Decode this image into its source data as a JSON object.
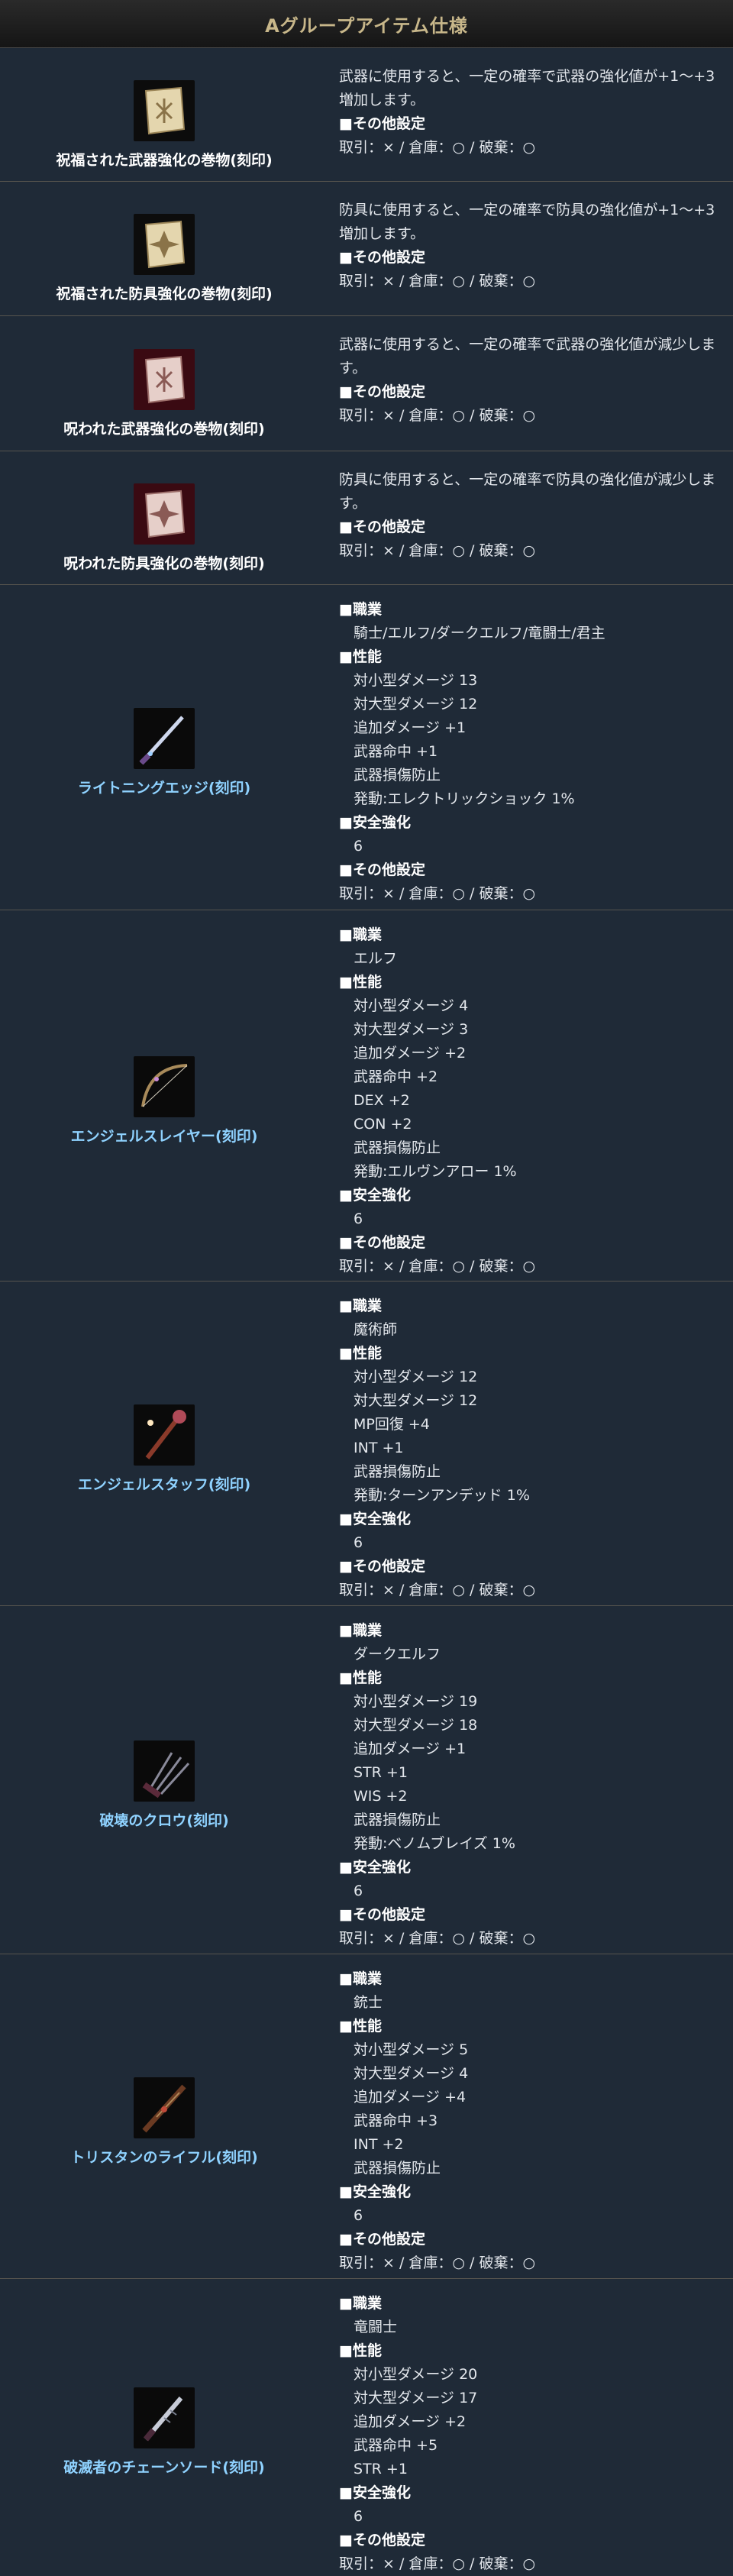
{
  "header": {
    "title": "Aグループアイテム仕様"
  },
  "labels": {
    "class": "■職業",
    "performance": "■性能",
    "safe": "■安全強化",
    "other": "■その他設定"
  },
  "scrolls": [
    {
      "name": "祝福された武器強化の巻物(刻印)",
      "desc": "武器に使用すると、一定の確率で武器の強化値が+1～+3増加します。",
      "trade": "取引：× / 倉庫：○ / 破棄：○"
    },
    {
      "name": "祝福された防具強化の巻物(刻印)",
      "desc": "防具に使用すると、一定の確率で防具の強化値が+1～+3増加します。",
      "trade": "取引：× / 倉庫：○ / 破棄：○"
    },
    {
      "name": "呪われた武器強化の巻物(刻印)",
      "desc": "武器に使用すると、一定の確率で武器の強化値が減少します。",
      "trade": "取引：× / 倉庫：○ / 破棄：○"
    },
    {
      "name": "呪われた防具強化の巻物(刻印)",
      "desc": "防具に使用すると、一定の確率で防具の強化値が減少します。",
      "trade": "取引：× / 倉庫：○ / 破棄：○"
    }
  ],
  "items": [
    {
      "name": "ライトニングエッジ(刻印)",
      "class": "騎士/エルフ/ダークエルフ/竜闘士/君主",
      "stats": [
        "対小型ダメージ 13",
        "対大型ダメージ 12",
        "追加ダメージ +1",
        "武器命中 +1",
        "武器損傷防止",
        "発動:エレクトリックショック 1%"
      ],
      "safe": "6",
      "trade": "取引：× / 倉庫：○ / 破棄：○"
    },
    {
      "name": "エンジェルスレイヤー(刻印)",
      "class": "エルフ",
      "stats": [
        "対小型ダメージ 4",
        "対大型ダメージ 3",
        "追加ダメージ +2",
        "武器命中 +2",
        "DEX +2",
        "CON +2",
        "武器損傷防止",
        "発動:エルヴンアロー 1%"
      ],
      "safe": "6",
      "trade": "取引：× / 倉庫：○ / 破棄：○"
    },
    {
      "name": "エンジェルスタッフ(刻印)",
      "class": "魔術師",
      "stats": [
        "対小型ダメージ 12",
        "対大型ダメージ 12",
        "MP回復 +4",
        "INT +1",
        "武器損傷防止",
        "発動:ターンアンデッド 1%"
      ],
      "safe": "6",
      "trade": "取引：× / 倉庫：○ / 破棄：○"
    },
    {
      "name": "破壊のクロウ(刻印)",
      "class": "ダークエルフ",
      "stats": [
        "対小型ダメージ 19",
        "対大型ダメージ 18",
        "追加ダメージ +1",
        "STR +1",
        "WIS +2",
        "武器損傷防止",
        "発動:ベノムブレイズ 1%"
      ],
      "safe": "6",
      "trade": "取引：× / 倉庫：○ / 破棄：○"
    },
    {
      "name": "トリスタンのライフル(刻印)",
      "class": "銃士",
      "stats": [
        "対小型ダメージ 5",
        "対大型ダメージ 4",
        "追加ダメージ +4",
        "武器命中 +3",
        "INT +2",
        "武器損傷防止"
      ],
      "safe": "6",
      "trade": "取引：× / 倉庫：○ / 破棄：○"
    },
    {
      "name": "破滅者のチェーンソード(刻印)",
      "class": "竜闘士",
      "stats": [
        "対小型ダメージ 20",
        "対大型ダメージ 17",
        "追加ダメージ +2",
        "武器命中 +5",
        "STR +1"
      ],
      "safe": "6",
      "trade": "取引：× / 倉庫：○ / 破棄：○"
    }
  ],
  "icons": [
    "blessed-weapon-scroll-icon",
    "blessed-armor-scroll-icon",
    "cursed-weapon-scroll-icon",
    "cursed-armor-scroll-icon",
    "lightning-edge-icon",
    "angel-slayer-bow-icon",
    "angel-staff-icon",
    "destruction-claw-icon",
    "tristan-rifle-icon",
    "destroyer-chainsword-icon"
  ]
}
